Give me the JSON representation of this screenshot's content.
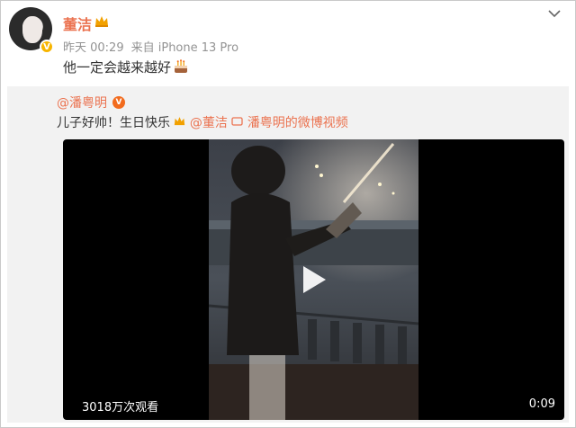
{
  "author": {
    "name": "董洁",
    "time": "昨天 00:29",
    "source": "来自 iPhone 13 Pro",
    "verified": "V"
  },
  "post": {
    "text": "他一定会越来越好"
  },
  "repost": {
    "author": "@潘粤明",
    "verified": "V",
    "text_prefix": "儿子好帅！生日快乐",
    "mention": "@董洁",
    "video_link": "潘粤明的微博视频"
  },
  "video": {
    "views": "3018万次观看",
    "duration": "0:09"
  },
  "icons": {
    "crown": "crown-icon",
    "cake": "cake-emoji-icon",
    "chevron": "chevron-down-icon",
    "play": "play-icon",
    "video_link": "video-link-icon"
  },
  "colors": {
    "name": "#eb7350",
    "repost_bg": "#f2f2f2",
    "badge": "#f7b500",
    "repost_badge": "#f26b1d"
  }
}
